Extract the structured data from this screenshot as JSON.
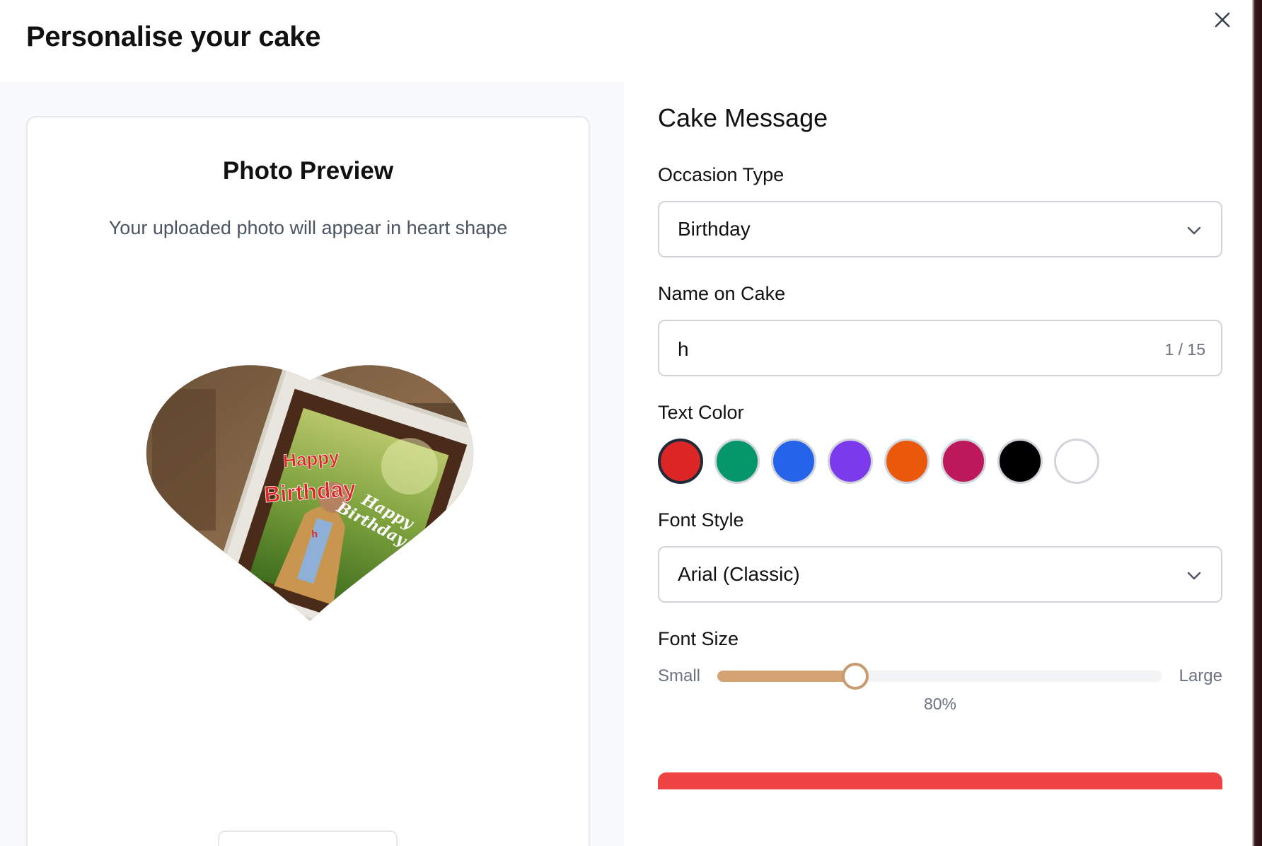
{
  "header": {
    "title": "Personalise your cake"
  },
  "preview": {
    "title": "Photo Preview",
    "subtitle": "Your uploaded photo will appear in heart shape",
    "cake_text": {
      "line1": "Happy",
      "line2": "Birthday",
      "diag1": "Happy",
      "diag2": "Birthday",
      "name": "h"
    }
  },
  "form": {
    "section_title": "Cake Message",
    "occasion": {
      "label": "Occasion Type",
      "value": "Birthday"
    },
    "name": {
      "label": "Name on Cake",
      "value": "h",
      "counter": "1 / 15"
    },
    "text_color": {
      "label": "Text Color",
      "selected": 0,
      "options": [
        "#dc2626",
        "#059669",
        "#2563eb",
        "#7c3aed",
        "#ea580c",
        "#be185d",
        "#000000",
        "#ffffff"
      ]
    },
    "font_style": {
      "label": "Font Style",
      "value": "Arial (Classic)"
    },
    "font_size": {
      "label": "Font Size",
      "min_label": "Small",
      "max_label": "Large",
      "value_label": "80%",
      "fraction": 0.31
    }
  }
}
